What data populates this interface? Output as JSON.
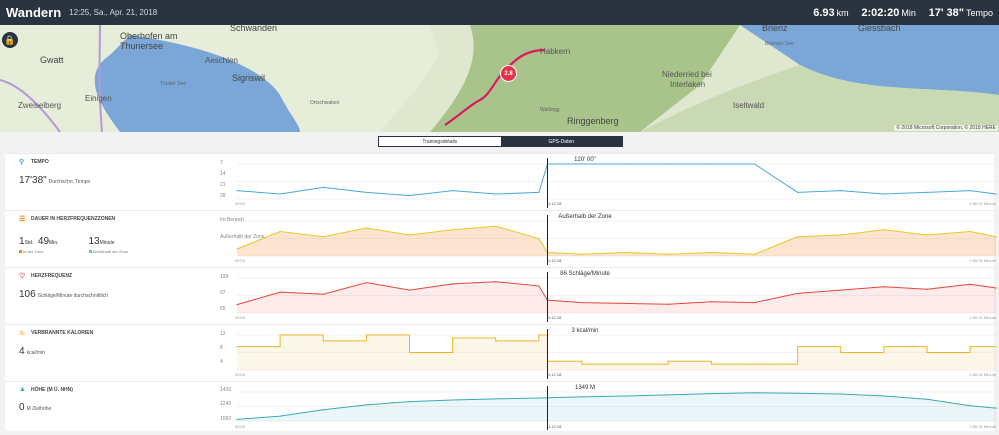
{
  "header": {
    "title": "Wandern",
    "date": "12:25, Sa., Apr. 21, 2018",
    "distance_value": "6.93",
    "distance_unit": "km",
    "duration_value": "2:02:20",
    "duration_unit": "Min",
    "pace_value": "17' 38\"",
    "pace_unit": "Tempo"
  },
  "map": {
    "labels": [
      "Schwanden",
      "Oberhofen am",
      "Thunersee",
      "Gwatt",
      "Aeschlen",
      "Sigriswil",
      "Zweiselberg",
      "Einigen",
      "Habkern",
      "Brienz",
      "Giessbach",
      "Niederried bei",
      "Interlaken",
      "Iseltwald",
      "Ringgenberg",
      "Thuner See",
      "Ortschwaben",
      "Brienzer See",
      "Waldegg"
    ],
    "marker": "2.8",
    "copyright": "© 2018 Microsoft Corporation, © 2018 HERE",
    "lock_icon": "lock-icon"
  },
  "tabs": [
    {
      "label": "Trainingsdetails",
      "active": false
    },
    {
      "label": "GPS-Daten",
      "active": true
    }
  ],
  "colors": {
    "header": "#2a3440",
    "pace": "#4aa8d8",
    "heart": "#e8453c",
    "calories": "#f0b429",
    "elevation": "#3aa9b6",
    "zone_orange": "#f0882a",
    "zone_yellow": "#e8c824",
    "zone_green": "#7bbf3b",
    "route": "#d81b60"
  },
  "metrics": {
    "pace": {
      "label": "Tempo",
      "value": "17'38\"",
      "sub": "Durchschn. Tempo",
      "icon": "shoe-icon"
    },
    "zones": {
      "label": "Dauer in Herzfrequenzzonen",
      "hours": "1",
      "hours_unit": "Std.",
      "minutes": "49",
      "minutes_unit": "Min.",
      "in_zone": "In der Zone",
      "other_value": "13",
      "other_unit": "Minute",
      "out_zone": "Außerhalb der Zone",
      "icon": "zones-icon"
    },
    "heart": {
      "label": "Herzfrequenz",
      "value": "106",
      "sub": "Schläge/Minute durchschnittlich",
      "icon": "heart-icon"
    },
    "calories": {
      "label": "Verbrannte Kalorien",
      "value": "4",
      "sub": "kcal/min",
      "icon": "flame-icon"
    },
    "elevation": {
      "label": "Höhe (m ü. NHN)",
      "value": "0",
      "sub": "M Zielhöhe",
      "icon": "mountain-icon"
    }
  },
  "charts": {
    "time_start": "00:00",
    "time_cursor": "1:12:18",
    "time_end": "2:56:31 Minute",
    "pace": {
      "yticks": [
        "7",
        "14",
        "21",
        "28"
      ],
      "cursor_label": "120' 00\""
    },
    "zones": {
      "yticks": [
        "Im Bereich",
        "Außerhalb der Zone"
      ],
      "cursor_label": "Außerhalb der Zone"
    },
    "heart": {
      "yticks": [
        "139",
        "97",
        "55"
      ],
      "cursor_label": "86 Schläge/Minute"
    },
    "calories": {
      "yticks": [
        "12",
        "8",
        "4"
      ],
      "cursor_label": "3 kcal/min"
    },
    "elevation": {
      "yticks": [
        "1420",
        "1240",
        "1060"
      ],
      "cursor_label": "1349 M"
    }
  },
  "chart_data": [
    {
      "type": "line",
      "title": "Tempo",
      "x": [
        0,
        10,
        20,
        30,
        40,
        50,
        60,
        70,
        72,
        80,
        90,
        100,
        110,
        120,
        130,
        140,
        150,
        160,
        170,
        176
      ],
      "values": [
        12,
        10,
        14,
        11,
        9,
        12,
        10,
        11,
        28,
        28,
        28,
        28,
        28,
        28,
        11,
        12,
        10,
        11,
        12,
        10
      ],
      "ylim": [
        7,
        28
      ]
    },
    {
      "type": "area",
      "title": "Dauer in Herzfrequenzzonen",
      "x": [
        0,
        10,
        20,
        30,
        40,
        50,
        60,
        70,
        72,
        80,
        90,
        100,
        110,
        120,
        130,
        140,
        150,
        160,
        170,
        176
      ],
      "values": [
        0.2,
        0.7,
        0.55,
        0.8,
        0.6,
        0.75,
        0.85,
        0.5,
        0.1,
        0.05,
        0.1,
        0.05,
        0.1,
        0.05,
        0.55,
        0.6,
        0.75,
        0.6,
        0.7,
        0.55
      ],
      "ylim": [
        0,
        1
      ]
    },
    {
      "type": "line",
      "title": "Herzfrequenz",
      "x": [
        0,
        10,
        20,
        30,
        40,
        50,
        60,
        70,
        72,
        80,
        90,
        100,
        110,
        120,
        130,
        140,
        150,
        160,
        170,
        176
      ],
      "values": [
        75,
        105,
        100,
        128,
        110,
        125,
        130,
        120,
        86,
        80,
        78,
        76,
        82,
        80,
        102,
        110,
        118,
        112,
        124,
        115
      ],
      "ylim": [
        55,
        139
      ]
    },
    {
      "type": "line",
      "title": "Verbrannte Kalorien",
      "x": [
        0,
        10,
        20,
        30,
        40,
        50,
        60,
        70,
        72,
        80,
        90,
        100,
        110,
        120,
        130,
        140,
        150,
        160,
        170,
        176
      ],
      "values": [
        8,
        12,
        10,
        12,
        6,
        11,
        10,
        12,
        3,
        2,
        2,
        3,
        2,
        2,
        8,
        6,
        8,
        6,
        8,
        8
      ],
      "ylim": [
        0,
        12
      ]
    },
    {
      "type": "area",
      "title": "Höhe (m ü. NHN)",
      "x": [
        0,
        10,
        20,
        30,
        40,
        50,
        60,
        70,
        72,
        80,
        90,
        100,
        110,
        120,
        130,
        140,
        150,
        160,
        170,
        176
      ],
      "values": [
        1080,
        1120,
        1200,
        1260,
        1300,
        1320,
        1335,
        1345,
        1349,
        1360,
        1370,
        1385,
        1400,
        1410,
        1405,
        1395,
        1370,
        1330,
        1250,
        1220
      ],
      "ylim": [
        1060,
        1420
      ]
    }
  ]
}
